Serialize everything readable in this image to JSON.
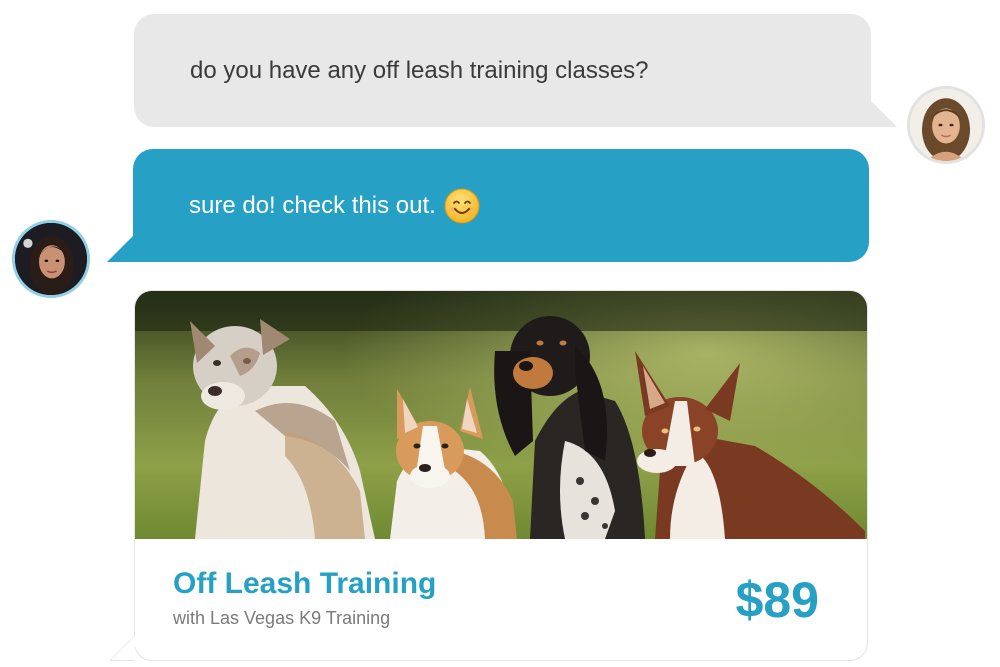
{
  "conversation": {
    "messages": [
      {
        "sender": "customer",
        "text": "do you have any off leash training classes?",
        "avatar": "customer-avatar"
      },
      {
        "sender": "business",
        "text": "sure do! check this out.",
        "emoji": "smiling-face-emoji",
        "avatar": "business-avatar"
      }
    ],
    "card": {
      "image": "dogs-photo",
      "title": "Off Leash Training",
      "subtitle": "with Las Vegas K9 Training",
      "price": "$89"
    }
  },
  "colors": {
    "accent": "#27a0c6",
    "customer_bubble": "#e8e8e8",
    "customer_text": "#3a3a3a",
    "subtitle_text": "#7a7a7a"
  }
}
